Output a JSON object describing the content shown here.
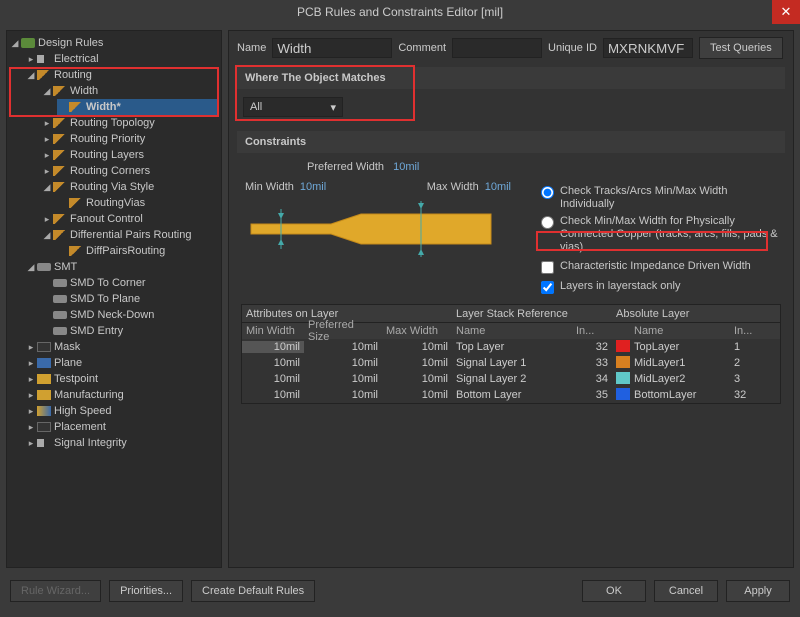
{
  "title": "PCB Rules and Constraints Editor [mil]",
  "tree": {
    "root": "Design Rules",
    "electrical": "Electrical",
    "routing": "Routing",
    "width_node": "Width",
    "width_rule": "Width*",
    "items": {
      "rt": "Routing Topology",
      "rp": "Routing Priority",
      "rl": "Routing Layers",
      "rc": "Routing Corners",
      "rvs": "Routing Via Style",
      "rv": "RoutingVias",
      "fc": "Fanout Control",
      "dpr": "Differential Pairs Routing",
      "dpr2": "DiffPairsRouting",
      "smt": "SMT",
      "stc": "SMD To Corner",
      "stp": "SMD To Plane",
      "snd": "SMD Neck-Down",
      "se": "SMD Entry",
      "mask": "Mask",
      "plane": "Plane",
      "tp": "Testpoint",
      "mfg": "Manufacturing",
      "hs": "High Speed",
      "pl": "Placement",
      "si": "Signal Integrity"
    }
  },
  "form": {
    "name_label": "Name",
    "name_value": "Width",
    "comment_label": "Comment",
    "comment_value": "",
    "uid_label": "Unique ID",
    "uid_value": "MXRNKMVF",
    "test_queries": "Test Queries"
  },
  "scope": {
    "header": "Where The Object Matches",
    "value": "All"
  },
  "constraints": {
    "header": "Constraints",
    "pref_label": "Preferred Width",
    "pref_val": "10mil",
    "min_label": "Min Width",
    "min_val": "10mil",
    "max_label": "Max Width",
    "max_val": "10mil",
    "opt_tracks": "Check Tracks/Arcs Min/Max Width Individually",
    "opt_conn": "Check Min/Max Width for Physically Connected Copper (tracks, arcs, fills, pads & vias)",
    "opt_imp": "Characteristic Impedance Driven Width",
    "opt_layers": "Layers in layerstack only"
  },
  "table": {
    "g1": "Attributes on Layer",
    "g2": "Layer Stack Reference",
    "g3": "Absolute Layer",
    "h_min": "Min Width",
    "h_pref": "Preferred Size",
    "h_max": "Max Width",
    "h_name": "Name",
    "h_in": "In...",
    "h_name2": "Name",
    "h_in2": "In...",
    "rows": [
      {
        "min": "10mil",
        "pref": "10mil",
        "max": "10mil",
        "lname": "Top Layer",
        "lin": "32",
        "aname": "TopLayer",
        "ain": "1",
        "color": "#e02020"
      },
      {
        "min": "10mil",
        "pref": "10mil",
        "max": "10mil",
        "lname": "Signal Layer 1",
        "lin": "33",
        "aname": "MidLayer1",
        "ain": "2",
        "color": "#d88020"
      },
      {
        "min": "10mil",
        "pref": "10mil",
        "max": "10mil",
        "lname": "Signal Layer 2",
        "lin": "34",
        "aname": "MidLayer2",
        "ain": "3",
        "color": "#60c8c8"
      },
      {
        "min": "10mil",
        "pref": "10mil",
        "max": "10mil",
        "lname": "Bottom Layer",
        "lin": "35",
        "aname": "BottomLayer",
        "ain": "32",
        "color": "#2060e0"
      }
    ]
  },
  "footer": {
    "wizard": "Rule Wizard...",
    "prio": "Priorities...",
    "create": "Create Default Rules",
    "ok": "OK",
    "cancel": "Cancel",
    "apply": "Apply"
  }
}
